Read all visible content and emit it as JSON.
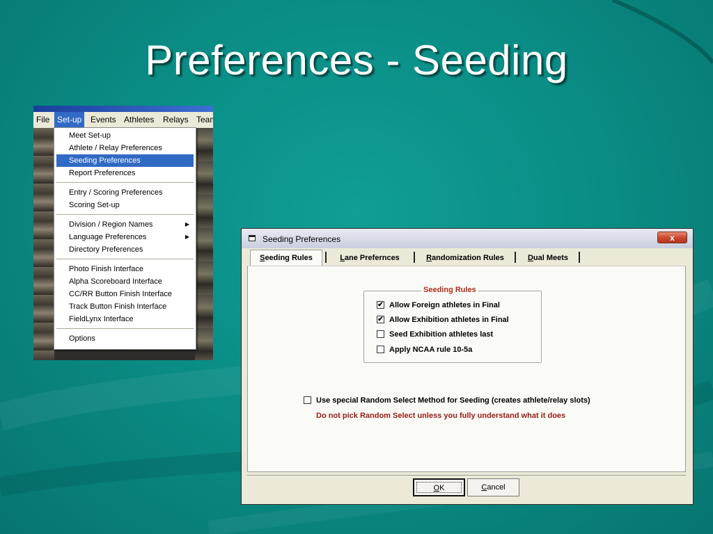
{
  "slide": {
    "title": "Preferences - Seeding"
  },
  "menu": {
    "menubar": [
      "File",
      "Set-up",
      "Events",
      "Athletes",
      "Relays",
      "Team"
    ],
    "active_menu": "Set-up",
    "items": [
      {
        "label": "Meet Set-up"
      },
      {
        "label": "Athlete / Relay Preferences"
      },
      {
        "label": "Seeding Preferences",
        "highlighted": true
      },
      {
        "label": "Report Preferences"
      },
      {
        "label": "Entry / Scoring Preferences"
      },
      {
        "label": "Scoring Set-up"
      },
      {
        "label": "Division / Region Names",
        "submenu": true
      },
      {
        "label": "Language Preferences",
        "submenu": true
      },
      {
        "label": "Directory Preferences"
      },
      {
        "label": "Photo Finish Interface"
      },
      {
        "label": "Alpha Scoreboard Interface"
      },
      {
        "label": "CC/RR Button Finish Interface"
      },
      {
        "label": "Track Button Finish Interface"
      },
      {
        "label": "FieldLynx Interface"
      },
      {
        "label": "Options"
      }
    ]
  },
  "dialog": {
    "title": "Seeding Preferences",
    "close_label": "x",
    "tabs": [
      {
        "key": "S",
        "rest": "eeding Rules",
        "selected": true
      },
      {
        "key": "L",
        "rest": "ane Prefernces"
      },
      {
        "key": "R",
        "rest": "andomization Rules"
      },
      {
        "key": "D",
        "rest": "ual Meets"
      }
    ],
    "group_title": "Seeding Rules",
    "checkboxes": [
      {
        "label": "Allow Foreign athletes in Final",
        "checked": true
      },
      {
        "label": "Allow Exhibition athletes in Final",
        "checked": true
      },
      {
        "label": "Seed Exhibition athletes last",
        "checked": false
      },
      {
        "label": "Apply NCAA rule 10-5a",
        "checked": false
      }
    ],
    "random_select": {
      "label": "Use special Random Select Method for Seeding (creates athlete/relay slots)",
      "checked": false
    },
    "warning": "Do not pick Random Select unless you fully understand what it does",
    "ok": {
      "key": "O",
      "rest": "K"
    },
    "cancel": {
      "key": "C",
      "rest": "ancel"
    },
    "checkmark": "✔",
    "submenu_arrow": "▶"
  },
  "colors": {
    "background": "#0a8e86",
    "highlight": "#316ac5",
    "warning": "#9b1b13",
    "group_title": "#b22d1a"
  }
}
